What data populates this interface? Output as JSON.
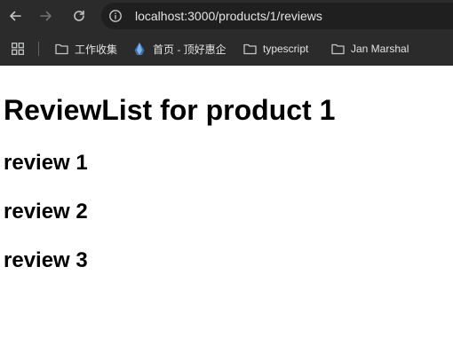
{
  "browser": {
    "url": "localhost:3000/products/1/reviews",
    "bookmarks": [
      {
        "label": "工作收集",
        "icon": "folder-icon"
      },
      {
        "label": "首页 - 顶好惠企",
        "icon": "site-favicon-icon"
      },
      {
        "label": "typescript",
        "icon": "folder-icon"
      },
      {
        "label": "Jan Marshal",
        "icon": "folder-icon"
      }
    ],
    "colors": {
      "chrome_bg": "#2b2b2b",
      "omnibox_bg": "#1f1f1f",
      "text": "#e3e3e3"
    }
  },
  "page": {
    "title": "ReviewList for product 1",
    "reviews": [
      "review 1",
      "review 2",
      "review 3"
    ]
  }
}
